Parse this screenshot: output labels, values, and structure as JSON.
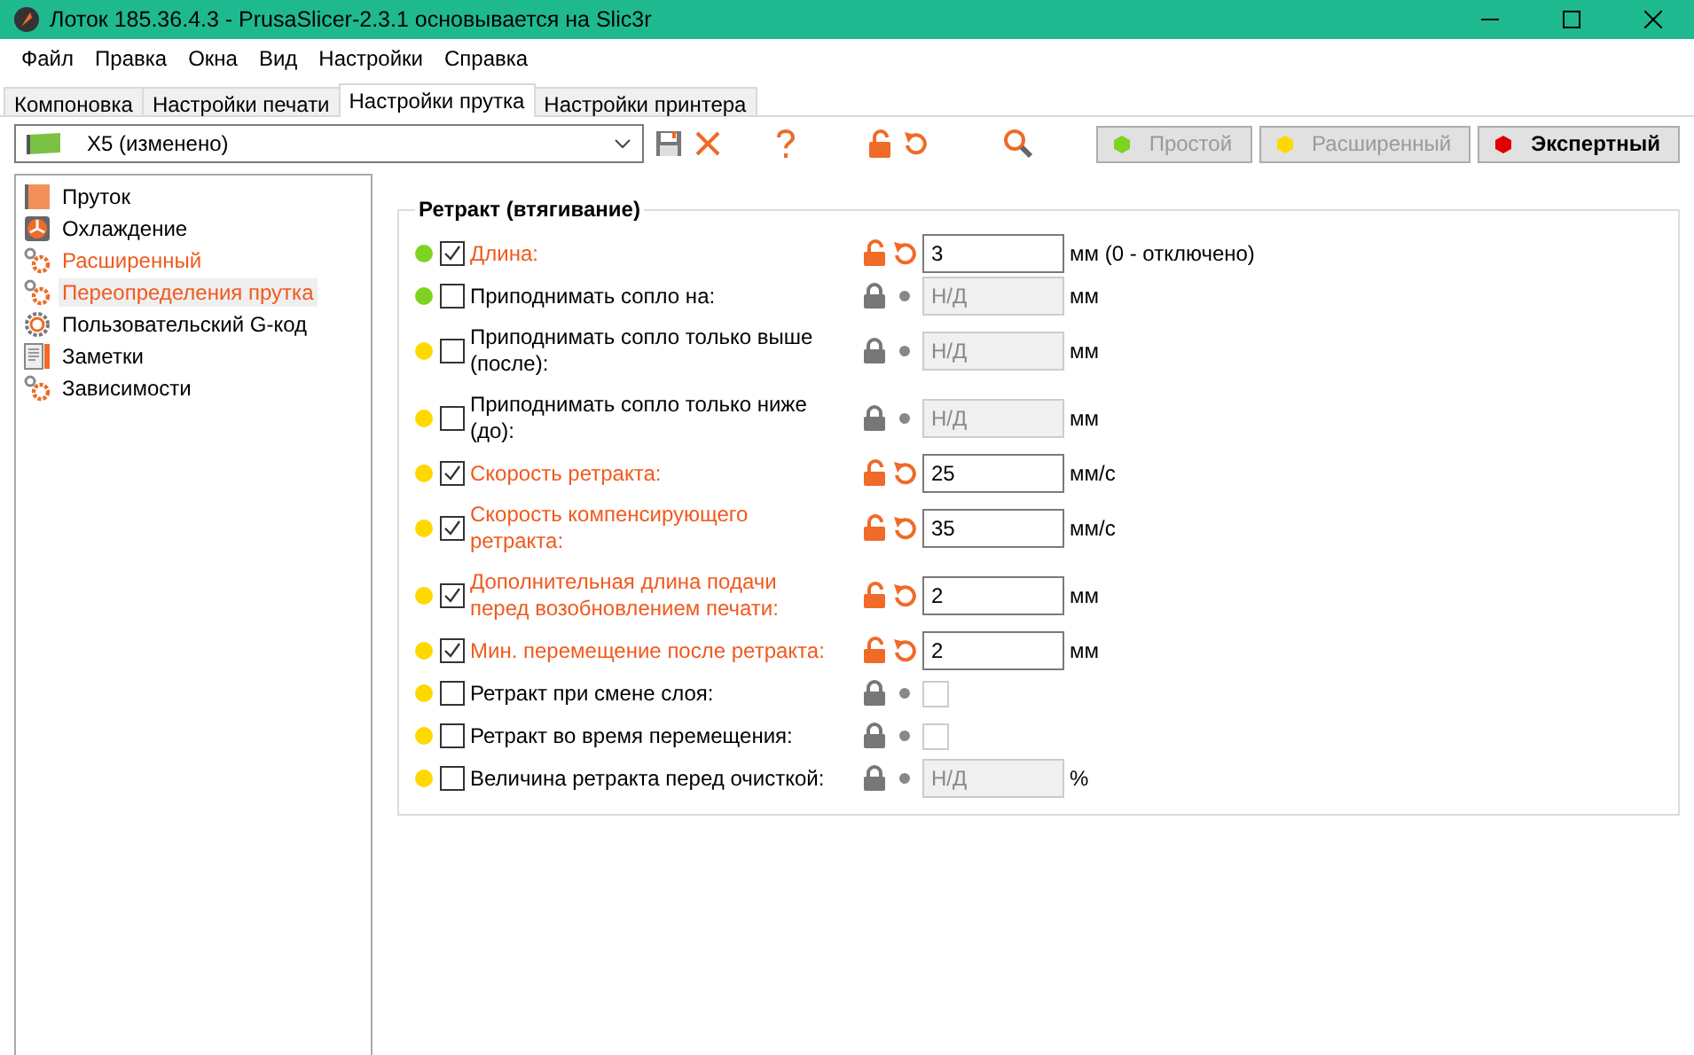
{
  "window": {
    "title": "Лоток 185.36.4.3 - PrusaSlicer-2.3.1 основывается на Slic3r"
  },
  "menu": [
    "Файл",
    "Правка",
    "Окна",
    "Вид",
    "Настройки",
    "Справка"
  ],
  "tabs": [
    {
      "label": "Компоновка",
      "selected": false
    },
    {
      "label": "Настройки печати",
      "selected": false
    },
    {
      "label": "Настройки прутка",
      "selected": true
    },
    {
      "label": "Настройки принтера",
      "selected": false
    }
  ],
  "preset": {
    "value": "X5 (изменено)"
  },
  "modes": [
    {
      "label": "Простой",
      "color": "#7ed321",
      "selected": false
    },
    {
      "label": "Расширенный",
      "color": "#ffd800",
      "selected": false
    },
    {
      "label": "Экспертный",
      "color": "#e00000",
      "selected": true
    }
  ],
  "sidebar": {
    "items": [
      {
        "kind": "filament",
        "label": "Пруток",
        "modified": false,
        "selected": false
      },
      {
        "kind": "fan",
        "label": "Охлаждение",
        "modified": false,
        "selected": false
      },
      {
        "kind": "gears",
        "label": "Расширенный",
        "modified": true,
        "selected": false
      },
      {
        "kind": "gears",
        "label": "Переопределения прутка",
        "modified": true,
        "selected": true
      },
      {
        "kind": "gear",
        "label": "Пользовательский G-код",
        "modified": false,
        "selected": false
      },
      {
        "kind": "notes",
        "label": "Заметки",
        "modified": false,
        "selected": false
      },
      {
        "kind": "gears",
        "label": "Зависимости",
        "modified": false,
        "selected": false
      }
    ]
  },
  "group": {
    "title": "Ретракт (втягивание)",
    "rows": [
      {
        "color": "#7ed321",
        "checked": true,
        "label": "Длина:",
        "modified": true,
        "field": {
          "kind": "input",
          "value": "3",
          "disabled": false
        },
        "unit": "мм (0 - отключено)"
      },
      {
        "color": "#7ed321",
        "checked": false,
        "label": "Приподнимать сопло на:",
        "modified": false,
        "field": {
          "kind": "input",
          "value": "Н/Д",
          "disabled": true
        },
        "unit": "мм"
      },
      {
        "color": "#ffd800",
        "checked": false,
        "label": "Приподнимать сопло только выше (после):",
        "modified": false,
        "field": {
          "kind": "input",
          "value": "Н/Д",
          "disabled": true
        },
        "unit": "мм"
      },
      {
        "color": "#ffd800",
        "checked": false,
        "label": "Приподнимать сопло только ниже (до):",
        "modified": false,
        "field": {
          "kind": "input",
          "value": "Н/Д",
          "disabled": true
        },
        "unit": "мм"
      },
      {
        "color": "#ffd800",
        "checked": true,
        "label": "Скорость ретракта:",
        "modified": true,
        "field": {
          "kind": "input",
          "value": "25",
          "disabled": false
        },
        "unit": "мм/с"
      },
      {
        "color": "#ffd800",
        "checked": true,
        "label": "Скорость компенсирующего ретракта:",
        "modified": true,
        "field": {
          "kind": "input",
          "value": "35",
          "disabled": false
        },
        "unit": "мм/с"
      },
      {
        "color": "#ffd800",
        "checked": true,
        "label": "Дополнительная длина подачи перед возобновлением печати:",
        "modified": true,
        "field": {
          "kind": "input",
          "value": "2",
          "disabled": false
        },
        "unit": "мм"
      },
      {
        "color": "#ffd800",
        "checked": true,
        "label": "Мин. перемещение после ретракта:",
        "modified": true,
        "field": {
          "kind": "input",
          "value": "2",
          "disabled": false
        },
        "unit": "мм"
      },
      {
        "color": "#ffd800",
        "checked": false,
        "label": "Ретракт при смене слоя:",
        "modified": false,
        "field": {
          "kind": "checkbox",
          "checked": false,
          "disabled": true
        }
      },
      {
        "color": "#ffd800",
        "checked": false,
        "label": "Ретракт во время перемещения:",
        "modified": false,
        "field": {
          "kind": "checkbox",
          "checked": false,
          "disabled": true
        }
      },
      {
        "color": "#ffd800",
        "checked": false,
        "label": "Величина ретракта перед очисткой:",
        "modified": false,
        "field": {
          "kind": "input",
          "value": "Н/Д",
          "disabled": true
        },
        "unit": "%"
      }
    ]
  }
}
